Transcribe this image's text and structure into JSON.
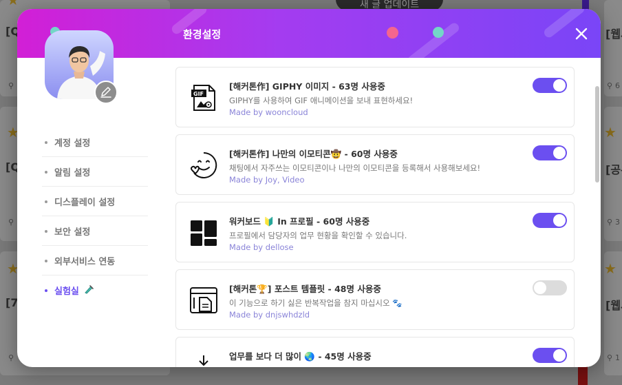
{
  "background": {
    "pill_label": "새 글 업데이트",
    "left_items": [
      "[Q",
      "[Q",
      "[7"
    ],
    "right_items": [
      "[웹시",
      "[공유",
      "[웹시"
    ],
    "right_meta": [
      "6",
      "3",
      "1"
    ]
  },
  "modal": {
    "title": "환경설정",
    "close_icon": "close-icon"
  },
  "menu": {
    "items": [
      {
        "label": "계정 설정",
        "active": false
      },
      {
        "label": "알림 설정",
        "active": false
      },
      {
        "label": "디스플레이 설정",
        "active": false
      },
      {
        "label": "보안 설정",
        "active": false
      },
      {
        "label": "외부서비스 연동",
        "active": false
      },
      {
        "label": "실험실",
        "active": true,
        "icon": "test-tube-icon"
      }
    ]
  },
  "features": [
    {
      "title": "[해커톤作] GIPHY 이미지 - 63명 사용중",
      "description": "GIPHY를 사용하여 GIF 애니메이션을 보내 표현하세요!",
      "author": "Made by wooncloud",
      "enabled": true,
      "icon": "gif-file-icon"
    },
    {
      "title": "[해커톤作] 나만의 이모티콘🤠 - 60명 사용중",
      "description": "채팅에서 자주쓰는 이모티콘이나 나만의 이모티콘을 등록해서 사용해보세요!",
      "author": "Made by Joy, Video",
      "enabled": true,
      "icon": "emoji-face-icon"
    },
    {
      "title": "워커보드 🔰 In 프로필 - 60명 사용중",
      "description": "프로필에서 담당자의 업무 현황을 확인할 수 있습니다.",
      "author": "Made by dellose",
      "enabled": true,
      "icon": "dashboard-grid-icon"
    },
    {
      "title": "[해커톤🏆] 포스트 템플릿 - 48명 사용중",
      "description": "이 기능으로 하기 싫은 반복작업을 참지 마십시오 🐾",
      "author": "Made by dnjswhdzld",
      "enabled": false,
      "icon": "template-document-icon"
    },
    {
      "title": "업무를 보다 더 많이 🌏 - 45명 사용중",
      "description": "",
      "author": "",
      "enabled": true,
      "icon": "inbox-download-icon"
    }
  ]
}
